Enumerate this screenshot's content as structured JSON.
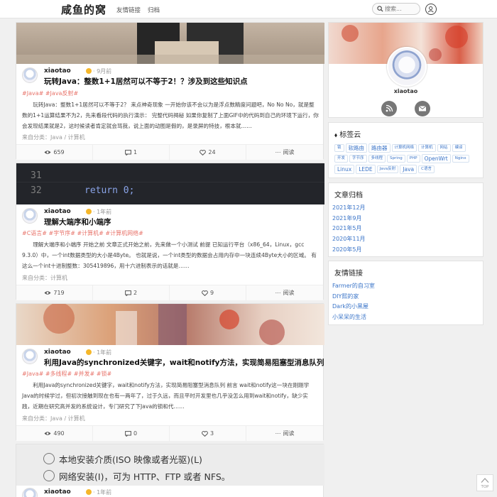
{
  "header": {
    "site_title": "咸鱼的窝",
    "nav": [
      "友情链接",
      "归档"
    ],
    "search_placeholder": "搜索..."
  },
  "posts": [
    {
      "author": "xiaotao",
      "time": "· 9月前",
      "title": "玩转Java：整数1+1居然可以不等于2！？涉及到这些知识点",
      "tags": "#Java# #Java反射#",
      "excerpt": "玩转Java：整数1+1居然可以不等于2？ 来点神奇现象 一开始你该不会以为是浮点数精度问题吧，No No No，就是整数的1+1运算结果不为2，先来看段代码的执行演示： 完整代码揭秘 如果你复制了上面GIF中的代码到自己的环境下运行，你会发现结果就是2，这时候读者肯定就会骂我，说上面的动图是假的，是录屏的特技，根本就……",
      "category": "来自分类：Java / 计算机",
      "views": "659",
      "comments": "1",
      "likes": "24",
      "read_label": "阅读"
    },
    {
      "author": "xiaotao",
      "time": "· 1年前",
      "title": "理解大端序和小端序",
      "tags": "#C语言# #字节序# #计算机# #计算机网络#",
      "excerpt": "理解大端序和小端序 开始之前 文章正式开始之前，先来做一个小测试 前提 已知运行平台（x86_64，Linux，gcc 9.3.0）中，一个int数据类型的大小是4Byte。 也就是说，一个int类型的数据会占用内存中一块连续4Byte大小的区域。 有这么一个int十进制整数：305419896，用十六进制表示的话就是……",
      "category": "来自分类：计算机",
      "banner_code": [
        "31",
        "32",
        "return 0;"
      ],
      "views": "719",
      "comments": "2",
      "likes": "9",
      "read_label": "阅读"
    },
    {
      "author": "xiaotao",
      "time": "· 1年前",
      "title": "利用Java的synchronized关键字，wait和notify方法，实现简易阻塞型消息队列",
      "tags": "#Java# #多线程# #并发# #锁#",
      "excerpt": "利用Java的synchronized关键字，wait和notify方法，实现简易阻塞型消息队列 前言 wait和notify这一块在刚刚学Java的时候学过，但初次接触到现在也有一两年了，过于久远，而且平时开发里也几乎没怎么用到wait和notify，缺少实践，近期在研究高并发的系统设计，专门研究了下Java的锁和代……",
      "category": "来自分类：Java / 计算机",
      "views": "490",
      "comments": "0",
      "likes": "3",
      "read_label": "阅读"
    },
    {
      "author": "xiaotao",
      "time": "· 1年前",
      "banner_lines": [
        "本地安装介质(ISO 映像或者光驱)(L)",
        "网络安装(I)，可为 HTTP、FTP 或者 NFS。"
      ]
    }
  ],
  "sidebar": {
    "profile_name": "xiaotao",
    "tags_title": "标签云",
    "tags": [
      {
        "label": "锁",
        "big": false
      },
      {
        "label": "软路由",
        "big": true
      },
      {
        "label": "路由器",
        "big": true
      },
      {
        "label": "计算机网络",
        "big": false
      },
      {
        "label": "计算机",
        "big": false
      },
      {
        "label": "网站",
        "big": false
      },
      {
        "label": "编译",
        "big": false
      },
      {
        "label": "开发",
        "big": false
      },
      {
        "label": "字节序",
        "big": false
      },
      {
        "label": "多线程",
        "big": false
      },
      {
        "label": "Spring",
        "big": false
      },
      {
        "label": "PHP",
        "big": false
      },
      {
        "label": "OpenWrt",
        "big": true
      },
      {
        "label": "Nginx",
        "big": false
      },
      {
        "label": "Linux",
        "big": true
      },
      {
        "label": "LEDE",
        "big": true
      },
      {
        "label": "Java反射",
        "big": false
      },
      {
        "label": "Java",
        "big": true
      },
      {
        "label": "C语言",
        "big": false
      }
    ],
    "archive_title": "文章归档",
    "archive": [
      "2021年12月",
      "2021年9月",
      "2021年5月",
      "2020年11月",
      "2020年5月"
    ],
    "friends_title": "友情链接",
    "friends": [
      "Farmer的自习室",
      "DIY熙的家",
      "Dark的小黑屋",
      "小呆呆的生活"
    ]
  },
  "back_to_top": "TOP",
  "colors": {
    "link": "#3a74c8",
    "tag": "#e8736a",
    "verified": "#f5b72a"
  }
}
